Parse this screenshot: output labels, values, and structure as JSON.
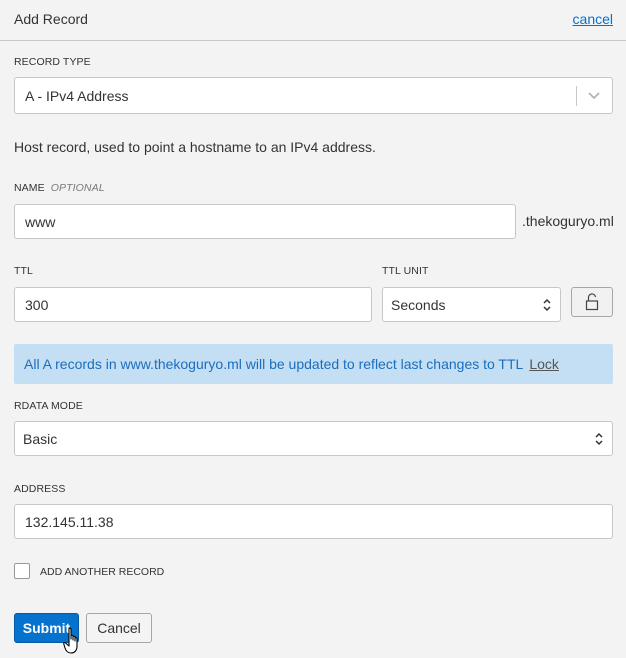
{
  "header": {
    "title": "Add Record",
    "cancel_link": "cancel"
  },
  "record_type": {
    "label": "RECORD TYPE",
    "value": "A - IPv4 Address"
  },
  "description": "Host record, used to point a hostname to an IPv4 address.",
  "name_field": {
    "label": "NAME",
    "optional": "OPTIONAL",
    "value": "www",
    "suffix": ".thekoguryo.ml"
  },
  "ttl": {
    "label": "TTL",
    "value": "300"
  },
  "ttl_unit": {
    "label": "TTL UNIT",
    "value": "Seconds"
  },
  "notice": {
    "text": "All A records in www.thekoguryo.ml will be updated to reflect last changes to TTL",
    "link": "Lock"
  },
  "rdata_mode": {
    "label": "RDATA MODE",
    "value": "Basic"
  },
  "address": {
    "label": "ADDRESS",
    "value": "132.145.11.38"
  },
  "add_another": {
    "label": "ADD ANOTHER RECORD",
    "checked": false
  },
  "buttons": {
    "submit": "Submit",
    "cancel": "Cancel"
  },
  "colors": {
    "primary": "#0572ce",
    "notice_bg": "#c4def3",
    "notice_text": "#1b6ebd"
  },
  "icons": [
    "chevron-down-icon",
    "up-down-arrows-icon",
    "unlock-icon",
    "hand-pointer-icon"
  ]
}
